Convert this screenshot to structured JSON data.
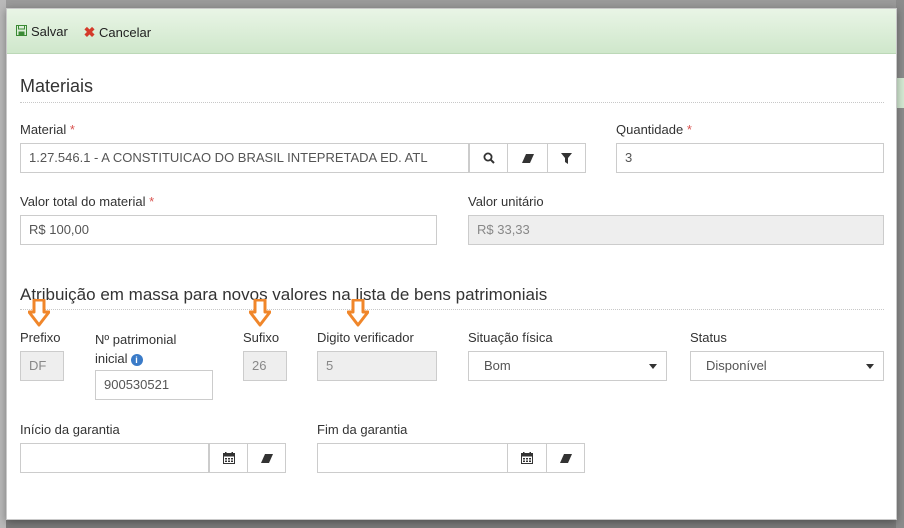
{
  "toolbar": {
    "save_label": "Salvar",
    "cancel_label": "Cancelar"
  },
  "materiais": {
    "title": "Materiais",
    "material_label": "Material",
    "material_value": "1.27.546.1 - A CONSTITUICAO DO BRASIL INTEPRETADA ED. ATL",
    "quantidade_label": "Quantidade",
    "quantidade_value": "3",
    "valor_total_label": "Valor total do material",
    "valor_total_value": "R$ 100,00",
    "valor_unitario_label": "Valor unitário",
    "valor_unitario_value": "R$ 33,33",
    "required_mark": "*"
  },
  "atribuicao": {
    "title": "Atribuição em massa para novos valores na lista de bens patrimoniais",
    "prefixo_label": "Prefixo",
    "prefixo_value": "DF",
    "patrimonial_label_line1": "Nº patrimonial",
    "patrimonial_label_line2": "inicial",
    "patrimonial_value": "900530521",
    "sufixo_label": "Sufixo",
    "sufixo_value": "26",
    "digito_label": "Digito verificador",
    "digito_value": "5",
    "situacao_label": "Situação física",
    "situacao_value": "Bom",
    "status_label": "Status",
    "status_value": "Disponível",
    "inicio_label": "Início da garantia",
    "inicio_value": "",
    "fim_label": "Fim da garantia",
    "fim_value": ""
  },
  "icons": {
    "info": "i",
    "colors": {
      "arrow": "#f0862a",
      "toolbar_green": "#cfe7cb",
      "required": "#d9534f"
    }
  }
}
